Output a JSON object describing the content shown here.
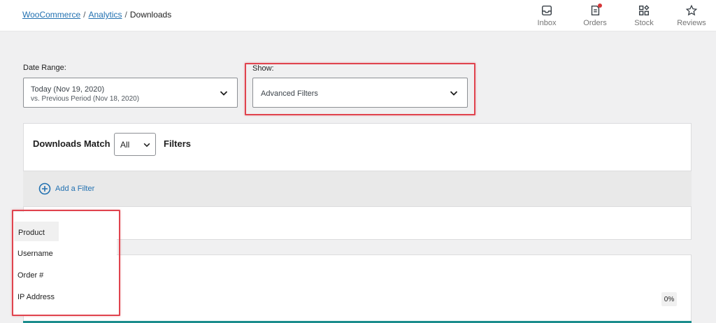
{
  "breadcrumb": {
    "root": "WooCommerce",
    "section": "Analytics",
    "current": "Downloads",
    "separator": "/"
  },
  "activity_bar": [
    {
      "label": "Inbox",
      "icon": "inbox-icon"
    },
    {
      "label": "Orders",
      "icon": "orders-icon"
    },
    {
      "label": "Stock",
      "icon": "stock-icon"
    },
    {
      "label": "Reviews",
      "icon": "star-icon"
    }
  ],
  "date_range": {
    "label": "Date Range:",
    "primary": "Today (Nov 19, 2020)",
    "compare": "vs. Previous Period (Nov 18, 2020)"
  },
  "show": {
    "label": "Show:",
    "value": "Advanced Filters"
  },
  "filters": {
    "match_prefix": "Downloads Match",
    "match_value": "All",
    "match_suffix": "Filters",
    "add_filter": "Add a Filter"
  },
  "filter_options": [
    "Product",
    "Username",
    "Order #",
    "IP Address"
  ],
  "summary": {
    "percent": "0%"
  },
  "colors": {
    "link": "#2271b1",
    "highlight": "#e0434e",
    "notification_dot": "#d63638",
    "teal": "#1b8d8d"
  }
}
